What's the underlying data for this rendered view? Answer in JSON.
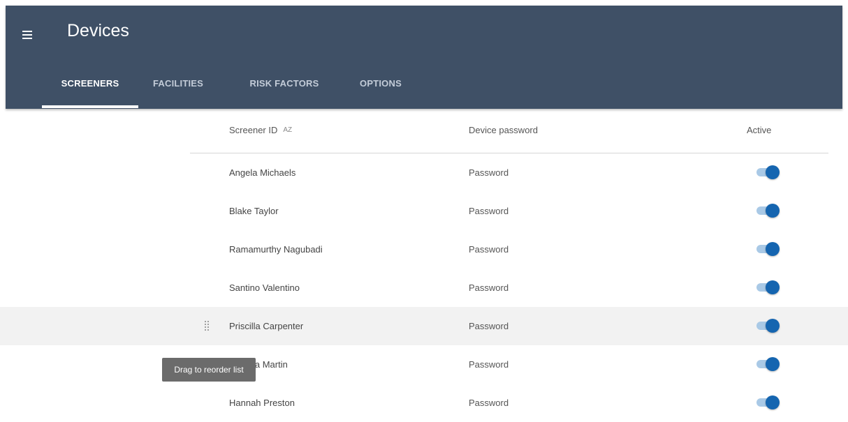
{
  "header": {
    "title": "Devices",
    "menu_icon": "hamburger-menu-icon",
    "background_color": "#3f5066"
  },
  "tabs": [
    {
      "label": "SCREENERS",
      "active": true
    },
    {
      "label": "FACILITIES",
      "active": false
    },
    {
      "label": "RISK FACTORS",
      "active": false
    },
    {
      "label": "OPTIONS",
      "active": false
    }
  ],
  "table": {
    "columns": {
      "screener_id": "Screener ID",
      "sort_icon": "AZ",
      "device_password": "Device password",
      "active": "Active"
    },
    "rows": [
      {
        "name": "Angela Michaels",
        "password": "Password",
        "active": true
      },
      {
        "name": "Blake Taylor",
        "password": "Password",
        "active": true
      },
      {
        "name": "Ramamurthy Nagubadi",
        "password": "Password",
        "active": true
      },
      {
        "name": "Santino Valentino",
        "password": "Password",
        "active": true
      },
      {
        "name": "Priscilla Carpenter",
        "password": "Password",
        "active": true
      },
      {
        "name": "Pamela Martin",
        "password": "Password",
        "active": true
      },
      {
        "name": "Hannah Preston",
        "password": "Password",
        "active": true
      }
    ],
    "toggle_color": "#1565b0"
  },
  "tooltip": {
    "text": "Drag to reorder list"
  }
}
